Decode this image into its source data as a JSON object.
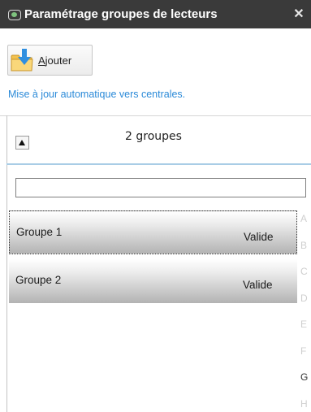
{
  "window": {
    "title": "Paramétrage groupes de lecteurs",
    "close_glyph": "✕"
  },
  "toolbar": {
    "add_label_first": "A",
    "add_label_rest": "jouter",
    "info_link": "Mise à jour automatique vers centrales."
  },
  "list": {
    "count_text": "2 groupes",
    "search_value": "",
    "rows": [
      {
        "name": "Groupe 1",
        "status": "Valide",
        "selected": true
      },
      {
        "name": "Groupe 2",
        "status": "Valide",
        "selected": false
      }
    ]
  },
  "alphabet_index": {
    "letters": [
      "A",
      "B",
      "C",
      "D",
      "E",
      "F",
      "G",
      "H"
    ],
    "active": "G"
  },
  "colors": {
    "titlebar": "#3a3a3a",
    "link": "#2b8ad8",
    "divider": "#a9cde6"
  }
}
